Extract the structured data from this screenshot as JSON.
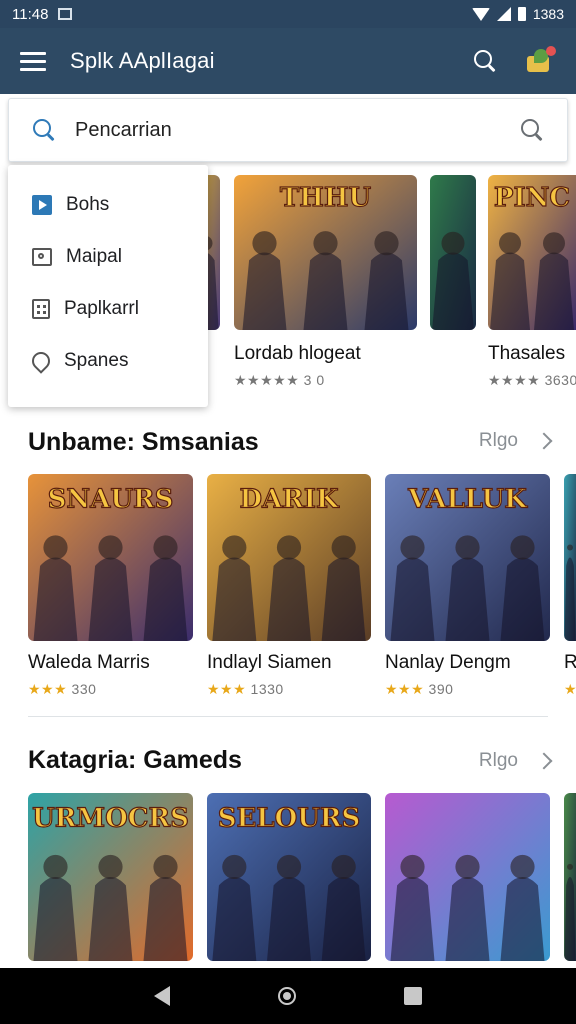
{
  "status_bar": {
    "time": "11:48",
    "battery_text": "1383"
  },
  "app_bar": {
    "title": "Splk AAplIagai"
  },
  "search": {
    "placeholder": "Pencarrian"
  },
  "dropdown": {
    "items": [
      {
        "label": "Bohs",
        "icon": "play-icon"
      },
      {
        "label": "Maipal",
        "icon": "image-icon"
      },
      {
        "label": "Paplkarrl",
        "icon": "grid-icon"
      },
      {
        "label": "Spanes",
        "icon": "pin-icon"
      }
    ]
  },
  "featured": {
    "cards": [
      {
        "title": "",
        "rating": "",
        "colors": [
          "#e0b530",
          "#4a3a7a"
        ]
      },
      {
        "title": "Lordab hlogeat",
        "rating": "★★★★★ 3 0",
        "art_text": "THHU",
        "colors": [
          "#f2a33a",
          "#2b3a6a"
        ]
      },
      {
        "title": "",
        "rating": "",
        "colors": [
          "#2f7a4a",
          "#1a2a44"
        ]
      },
      {
        "title": "Thasales",
        "rating": "★★★★ 3630",
        "art_text": "PINC",
        "colors": [
          "#f0b343",
          "#3a2a6a"
        ]
      }
    ]
  },
  "section1": {
    "title": "Unbame: Smsanias",
    "see_all": "Rlgo",
    "cards": [
      {
        "title": "Waleda Marris",
        "stars": "★★★",
        "rating_text": "330",
        "art_text": "SNAURS",
        "colors": [
          "#e7933a",
          "#3b2d6d"
        ]
      },
      {
        "title": "Indlayl Siamen",
        "stars": "★★★",
        "rating_text": "1330",
        "art_text": "DARIK",
        "colors": [
          "#e9b045",
          "#5a3d26"
        ]
      },
      {
        "title": "Nanlay Dengm",
        "stars": "★★★",
        "rating_text": "390",
        "art_text": "VALLUK",
        "colors": [
          "#6a7fb8",
          "#22294d"
        ]
      },
      {
        "title": "R",
        "stars": "★",
        "rating_text": "",
        "art_text": "",
        "colors": [
          "#3aa0b0",
          "#1d2a44"
        ]
      }
    ]
  },
  "section2": {
    "title": "Katagria: Gameds",
    "see_all": "Rlgo",
    "cards": [
      {
        "art_text": "URMOCRS",
        "colors": [
          "#2ea3a6",
          "#e26a2a"
        ]
      },
      {
        "art_text": "SELOURS",
        "colors": [
          "#4d6fb3",
          "#1a2244"
        ]
      },
      {
        "art_text": "",
        "colors": [
          "#b75ad0",
          "#3a9bd0"
        ]
      },
      {
        "art_text": "",
        "colors": [
          "#4a8a4a",
          "#1c2b3c"
        ]
      }
    ]
  },
  "colors": {
    "app_bar": "#2e4a64",
    "status_bar": "#2b4560",
    "accent": "#2f7ab8",
    "star": "#e8a81a"
  }
}
